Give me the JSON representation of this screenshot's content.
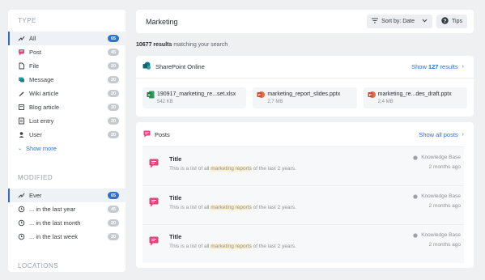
{
  "sidebar": {
    "type_title": "TYPE",
    "type_items": [
      {
        "label": "All",
        "count": "65",
        "icon": "all-icon",
        "active": true
      },
      {
        "label": "Post",
        "count": "45",
        "icon": "post-icon"
      },
      {
        "label": "File",
        "count": "20",
        "icon": "file-icon"
      },
      {
        "label": "Message",
        "count": "20",
        "icon": "message-icon"
      },
      {
        "label": "Wiki article",
        "count": "20",
        "icon": "wiki-icon"
      },
      {
        "label": "Blog article",
        "count": "20",
        "icon": "blog-icon"
      },
      {
        "label": "List entry",
        "count": "20",
        "icon": "list-icon"
      },
      {
        "label": "User",
        "count": "20",
        "icon": "user-icon"
      }
    ],
    "show_more": "Show more",
    "modified_title": "MODIFIED",
    "modified_items": [
      {
        "label": "Ever",
        "count": "65",
        "active": true
      },
      {
        "label": "... in the last year",
        "count": "45"
      },
      {
        "label": "... in the last month",
        "count": "20"
      },
      {
        "label": "... in the last week",
        "count": "20"
      }
    ],
    "locations_title": "LOCATIONS"
  },
  "header": {
    "title": "Marketing",
    "sort_label": "Sort by: Date",
    "tips_label": "Tips"
  },
  "results": {
    "count": "10677 results",
    "suffix": " matching your search"
  },
  "sharepoint": {
    "title": "SharePoint Online",
    "show_prefix": "Show ",
    "show_count": "127",
    "show_suffix": " results",
    "files": [
      {
        "name": "190917_marketing_re...set.xlsx",
        "size": "542 KB",
        "type": "excel"
      },
      {
        "name": "marketing_report_slides.pptx",
        "size": "2,7 MB",
        "type": "powerpoint"
      },
      {
        "name": "marketing_re...des_draft.pptx",
        "size": "2,4 MB",
        "type": "powerpoint"
      }
    ]
  },
  "posts": {
    "title": "Posts",
    "show_all": "Show all posts",
    "items": [
      {
        "title": "Title",
        "desc_pre": "This is a list of all ",
        "desc_hl": "marketing reports",
        "desc_post": " of the last 2 years.",
        "source": "Knowledge Base",
        "time": "2 months ago"
      },
      {
        "title": "Title",
        "desc_pre": "This is a list of all ",
        "desc_hl": "marketing reports",
        "desc_post": " of the last 2 years.",
        "source": "Knowledge Base",
        "time": "2 months ago"
      },
      {
        "title": "Title",
        "desc_pre": "This is a list of all ",
        "desc_hl": "marketing reports",
        "desc_post": " of the last 2 years.",
        "source": "Knowledge Base",
        "time": "2 months ago"
      }
    ]
  },
  "colors": {
    "accent": "#2e6fd6",
    "post": "#e0467c",
    "excel": "#1f7a44",
    "powerpoint": "#d04a2c",
    "sharepoint": "#0b7d8a"
  }
}
